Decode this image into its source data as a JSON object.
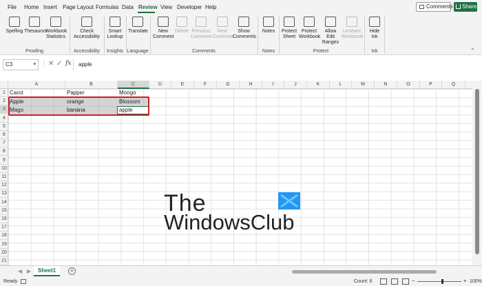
{
  "menu": {
    "tabs": [
      "File",
      "Home",
      "Insert",
      "Page Layout",
      "Formulas",
      "Data",
      "Review",
      "View",
      "Developer",
      "Help"
    ],
    "active_tab": "Review",
    "comments_label": "Comments",
    "share_label": "Share"
  },
  "ribbon": {
    "proofing": {
      "spelling": "Spelling",
      "thesaurus": "Thesaurus",
      "workbook_stats": "Workbook Statistics",
      "group": "Proofing"
    },
    "accessibility": {
      "check": "Check Accessibility",
      "group": "Accessibility"
    },
    "insights": {
      "smart_lookup": "Smart Lookup",
      "group": "Insights"
    },
    "language": {
      "translate": "Translate",
      "group": "Language"
    },
    "comments": {
      "new_comment": "New Comment",
      "delete": "Delete",
      "previous": "Previous Comment",
      "next": "Next Comment",
      "show": "Show Comments",
      "group": "Comments"
    },
    "notes": {
      "notes": "Notes",
      "group": "Notes"
    },
    "protect": {
      "protect_sheet": "Protect Sheet",
      "protect_workbook": "Protect Workbook",
      "allow_edit": "Allow Edit Ranges",
      "unshare": "Unshare Workbook",
      "group": "Protect"
    },
    "ink": {
      "hide_ink": "Hide Ink",
      "group": "Ink"
    }
  },
  "formula_bar": {
    "name_box": "C3",
    "formula": "apple"
  },
  "grid": {
    "columns": [
      "A",
      "B",
      "C",
      "D",
      "E",
      "F",
      "G",
      "H",
      "I",
      "J",
      "K",
      "L",
      "M",
      "N",
      "O",
      "P",
      "Q"
    ],
    "rows": [
      "1",
      "2",
      "3",
      "4",
      "5",
      "6",
      "7",
      "8",
      "9",
      "10",
      "11",
      "12",
      "13",
      "14",
      "15",
      "16",
      "17",
      "18",
      "19",
      "20",
      "21"
    ],
    "cells": {
      "A1": "Carot",
      "B1": "Papper",
      "C1": "Mongo",
      "A2": "Apple",
      "B2": "orange",
      "C2": "Blossom",
      "A3": "Mago",
      "B3": "banana",
      "C3": "apple"
    }
  },
  "watermark": {
    "line1": "The",
    "line2": "WindowsClub",
    "logo_color": "#2196f3"
  },
  "sheets": {
    "active": "Sheet1"
  },
  "status": {
    "ready": "Ready",
    "count": "Count: 6",
    "zoom": "100%"
  }
}
